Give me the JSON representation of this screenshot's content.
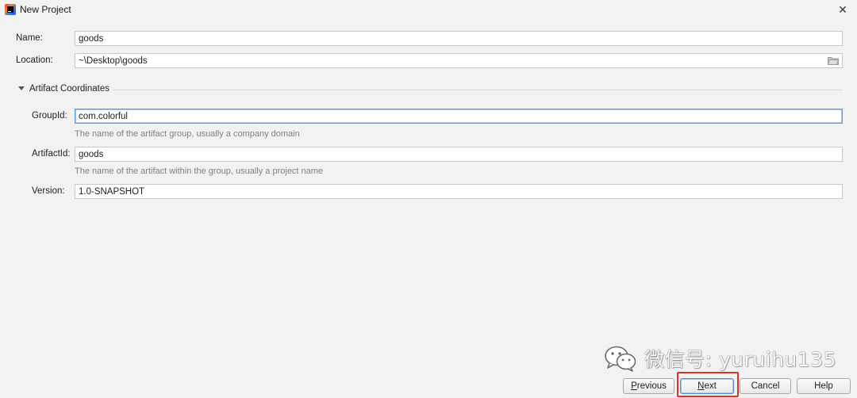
{
  "window": {
    "title": "New Project",
    "close_glyph": "✕"
  },
  "form": {
    "name_label": "Name:",
    "name_value": "goods",
    "location_label": "Location:",
    "location_value": "~\\Desktop\\goods",
    "section_title": "Artifact Coordinates",
    "groupid_label": "GroupId:",
    "groupid_value": "com.colorful",
    "groupid_hint": "The name of the artifact group, usually a company domain",
    "artifactid_label": "ArtifactId:",
    "artifactid_value": "goods",
    "artifactid_hint": "The name of the artifact within the group, usually a project name",
    "version_label": "Version:",
    "version_value": "1.0-SNAPSHOT"
  },
  "buttons": {
    "previous_prefix": "",
    "previous_mnemonic": "P",
    "previous_rest": "revious",
    "next_mnemonic": "N",
    "next_rest": "ext",
    "cancel": "Cancel",
    "help": "Help"
  },
  "watermark": {
    "text": "微信号: yuruihu135",
    "icon": "wechat-icon"
  },
  "colors": {
    "focus": "#5f9bd6",
    "highlight": "#e0302b",
    "hint": "#7f7f7f"
  }
}
